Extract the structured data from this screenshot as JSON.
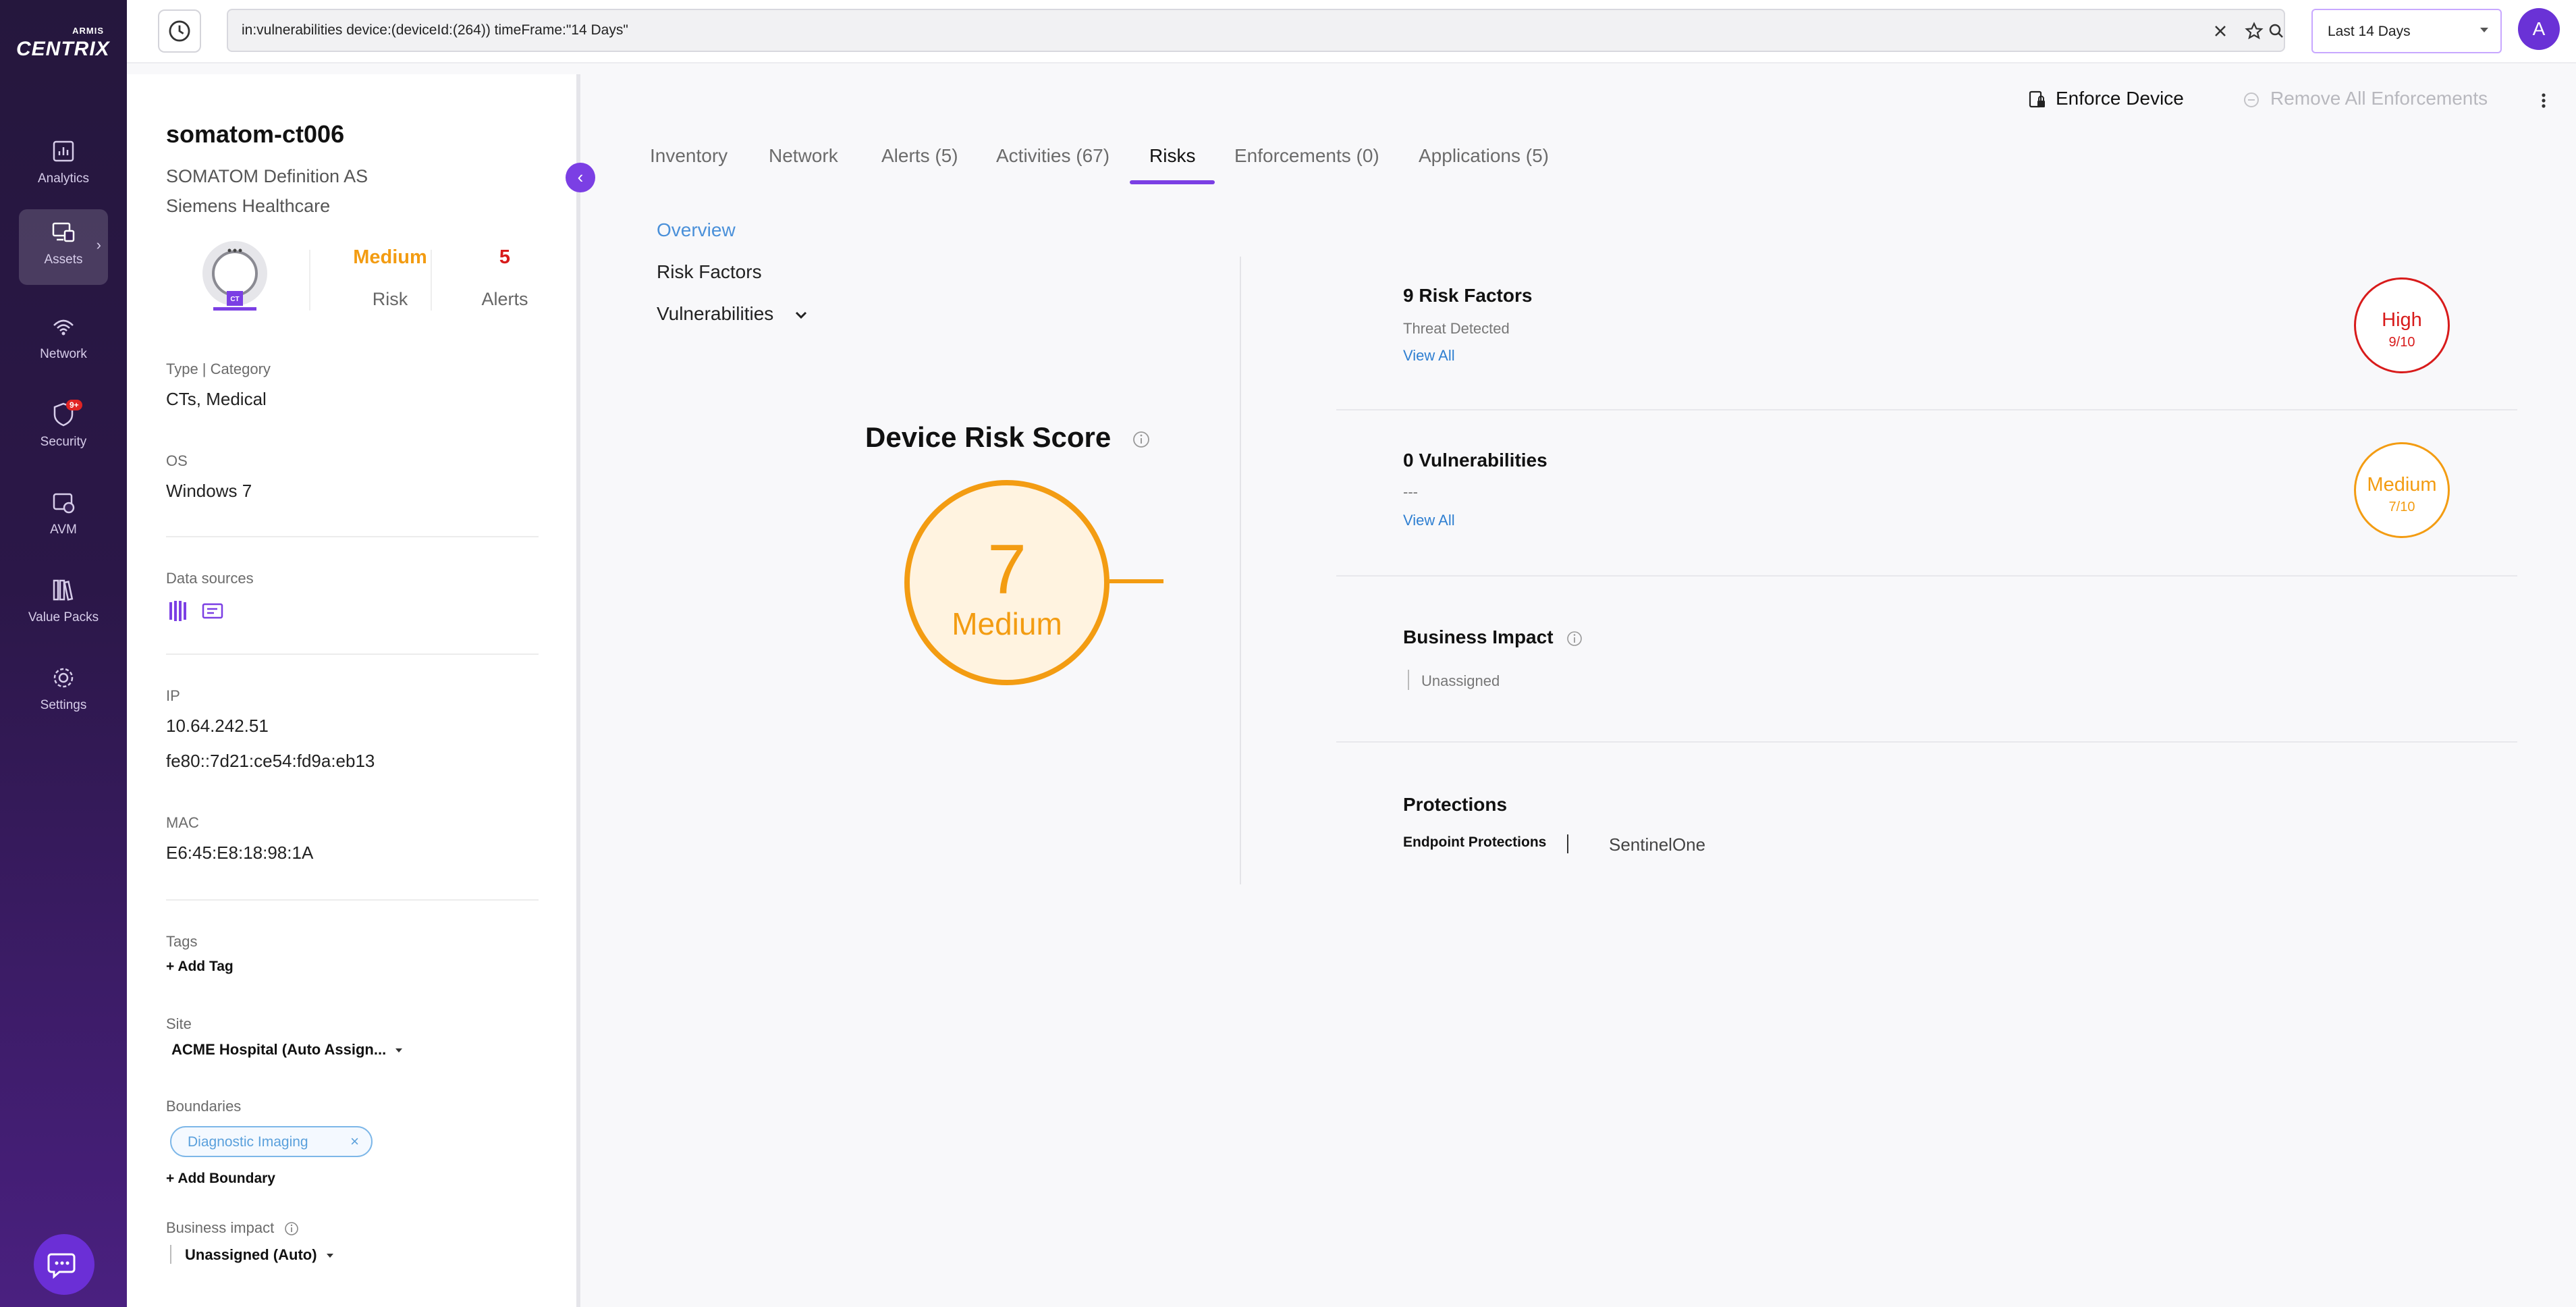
{
  "nav": {
    "logo_small": "ARMIS",
    "logo_big": "CENTRIX",
    "items": [
      {
        "label": "Analytics",
        "icon": "analytics-icon"
      },
      {
        "label": "Assets",
        "icon": "assets-icon"
      },
      {
        "label": "Network",
        "icon": "network-icon"
      },
      {
        "label": "Security",
        "icon": "security-icon",
        "badge": "9+"
      },
      {
        "label": "AVM",
        "icon": "avm-icon"
      },
      {
        "label": "Value Packs",
        "icon": "value-packs-icon"
      },
      {
        "label": "Settings",
        "icon": "settings-icon"
      }
    ]
  },
  "topbar": {
    "query": "in:vulnerabilities device:(deviceId:(264)) timeFrame:\"14 Days\"",
    "time_range": "Last 14 Days",
    "avatar_initial": "A"
  },
  "device": {
    "name": "somatom-ct006",
    "model": "SOMATOM Definition AS",
    "vendor": "Siemens Healthcare",
    "image_badge": "CT",
    "risk_value": "Medium",
    "risk_label": "Risk",
    "alerts_value": "5",
    "alerts_label": "Alerts",
    "type_label": "Type | Category",
    "type_value": "CTs, Medical",
    "os_label": "OS",
    "os_value": "Windows 7",
    "data_sources_label": "Data sources",
    "ip_label": "IP",
    "ipv4": "10.64.242.51",
    "ipv6": "fe80::7d21:ce54:fd9a:eb13",
    "mac_label": "MAC",
    "mac_value": "E6:45:E8:18:98:1A",
    "tags_label": "Tags",
    "add_tag": "+ Add Tag",
    "site_label": "Site",
    "site_value": "ACME Hospital (Auto Assign...",
    "boundaries_label": "Boundaries",
    "boundary_chip": "Diagnostic Imaging",
    "add_boundary": "+ Add Boundary",
    "business_impact_label": "Business impact",
    "business_impact_value": "Unassigned (Auto)"
  },
  "actions": {
    "enforce": "Enforce Device",
    "remove_all": "Remove All Enforcements"
  },
  "tabs": [
    "Inventory",
    "Network",
    "Alerts (5)",
    "Activities (67)",
    "Risks",
    "Enforcements (0)",
    "Applications (5)"
  ],
  "risks_nav": {
    "overview": "Overview",
    "risk_factors": "Risk Factors",
    "vulnerabilities": "Vulnerabilities"
  },
  "score": {
    "title": "Device Risk Score",
    "value": "7",
    "level": "Medium",
    "color": "#f39c12"
  },
  "cards": {
    "risk_factors": {
      "title": "9 Risk Factors",
      "sub": "Threat Detected",
      "link": "View All",
      "level": "High",
      "score": "9/10",
      "color": "#d81b1b"
    },
    "vulnerabilities": {
      "title": "0 Vulnerabilities",
      "sub": "---",
      "link": "View All",
      "level": "Medium",
      "score": "7/10",
      "color": "#f39c12"
    },
    "business_impact": {
      "title": "Business Impact",
      "value": "Unassigned"
    },
    "protections": {
      "title": "Protections",
      "label": "Endpoint Protections",
      "value": "SentinelOne"
    }
  }
}
